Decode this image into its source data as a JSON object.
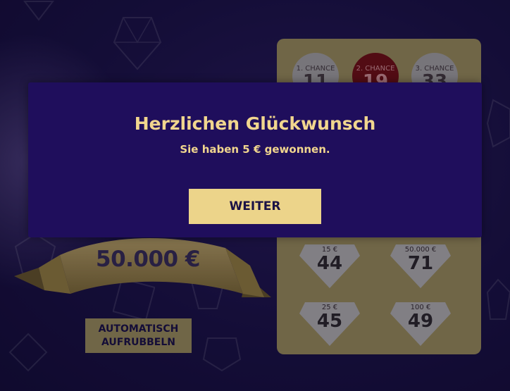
{
  "chances": [
    {
      "label": "1. CHANCE",
      "number": "11",
      "active": false
    },
    {
      "label": "2. CHANCE",
      "number": "19",
      "active": true
    },
    {
      "label": "3. CHANCE",
      "number": "33",
      "active": false
    }
  ],
  "tiles": [
    {
      "prize": "15 €",
      "number": "44"
    },
    {
      "prize": "50.000 €",
      "number": "71"
    },
    {
      "prize": "25 €",
      "number": "45"
    },
    {
      "prize": "100 €",
      "number": "49"
    }
  ],
  "jackpot": "50.000 €",
  "auto_button": {
    "line1": "AUTOMATISCH",
    "line2": "AUFRUBBELN"
  },
  "modal": {
    "title": "Herzlichen Glückwunsch",
    "subtitle": "Sie haben 5 € gewonnen.",
    "button": "WEITER"
  },
  "colors": {
    "background": "#1b1246",
    "card": "#a89a5f",
    "modal": "#1f0e5c",
    "accent": "#ecd48a",
    "active_chance": "#7a1010"
  }
}
